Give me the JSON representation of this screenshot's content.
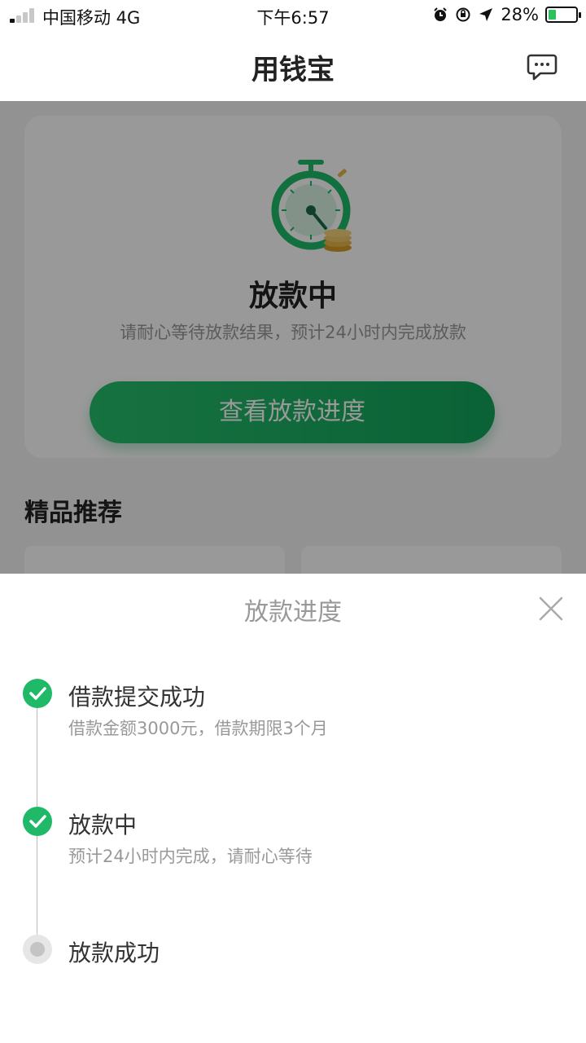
{
  "status_bar": {
    "carrier": "中国移动 4G",
    "time": "下午6:57",
    "battery": "28%",
    "battery_level": 0.28,
    "icons": [
      "alarm-icon",
      "orientation-lock-icon",
      "location-arrow-icon",
      "battery-charging-icon"
    ]
  },
  "header": {
    "title": "用钱宝",
    "chat_icon": "chat-bubble-icon"
  },
  "status_card": {
    "icon": "stopwatch-coins-icon",
    "title": "放款中",
    "subtitle": "请耐心等待放款结果，预计24小时内完成放款",
    "button_label": "查看放款进度"
  },
  "recommend": {
    "title": "精品推荐"
  },
  "progress_sheet": {
    "title": "放款进度",
    "close_icon": "close-icon",
    "steps": [
      {
        "title": "借款提交成功",
        "desc": "借款金额3000元，借款期限3个月",
        "state": "done"
      },
      {
        "title": "放款中",
        "desc": "预计24小时内完成，请耐心等待",
        "state": "done"
      },
      {
        "title": "放款成功",
        "desc": "",
        "state": "pending"
      }
    ]
  },
  "colors": {
    "primary": "#1fb968",
    "text_dark": "#333333",
    "text_muted": "#999999",
    "overlay": "rgba(0,0,0,0.4)"
  }
}
